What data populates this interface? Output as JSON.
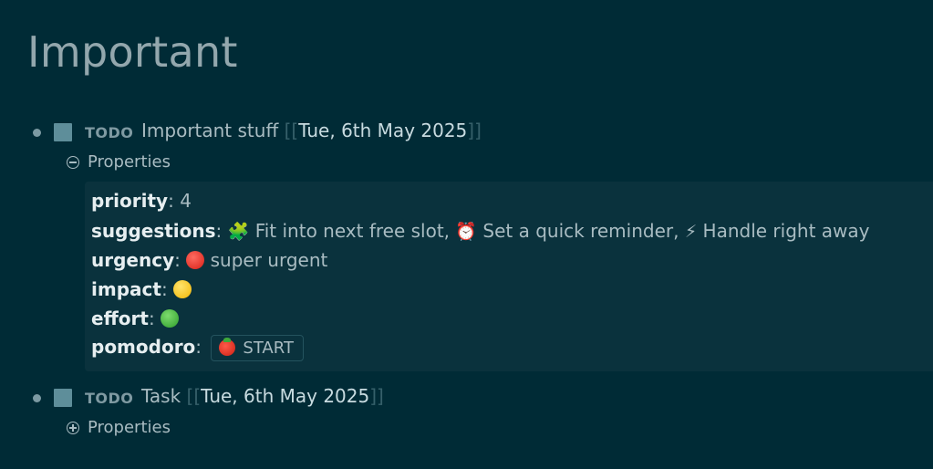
{
  "page": {
    "title": "Important"
  },
  "blocks": [
    {
      "marker": "TODO",
      "text": "Important stuff",
      "date": "Tue, 6th May 2025",
      "bracket_open": "[[",
      "bracket_close": "]]",
      "properties_label": "Properties",
      "properties_expanded": true,
      "properties": {
        "priority": {
          "key": "priority",
          "value": "4"
        },
        "suggestions": {
          "key": "suggestions",
          "items": [
            {
              "icon": "🧩",
              "text": "Fit into next free slot"
            },
            {
              "icon": "⏰",
              "text": "Set a quick reminder"
            },
            {
              "icon": "⚡",
              "text": "Handle right away"
            }
          ]
        },
        "urgency": {
          "key": "urgency",
          "value": "super urgent",
          "icon": "red-circle-icon"
        },
        "impact": {
          "key": "impact",
          "icon": "yellow-circle-icon"
        },
        "effort": {
          "key": "effort",
          "icon": "green-circle-icon"
        },
        "pomodoro": {
          "key": "pomodoro",
          "button_label": "START",
          "icon": "tomato-icon"
        }
      }
    },
    {
      "marker": "TODO",
      "text": "Task",
      "date": "Tue, 6th May 2025",
      "bracket_open": "[[",
      "bracket_close": "]]",
      "properties_label": "Properties",
      "properties_expanded": false
    }
  ],
  "colors": {
    "background": "#002b36",
    "title": "#93a7ad",
    "checkbox": "#5e8e9a",
    "properties_bg": "#0a323d"
  }
}
